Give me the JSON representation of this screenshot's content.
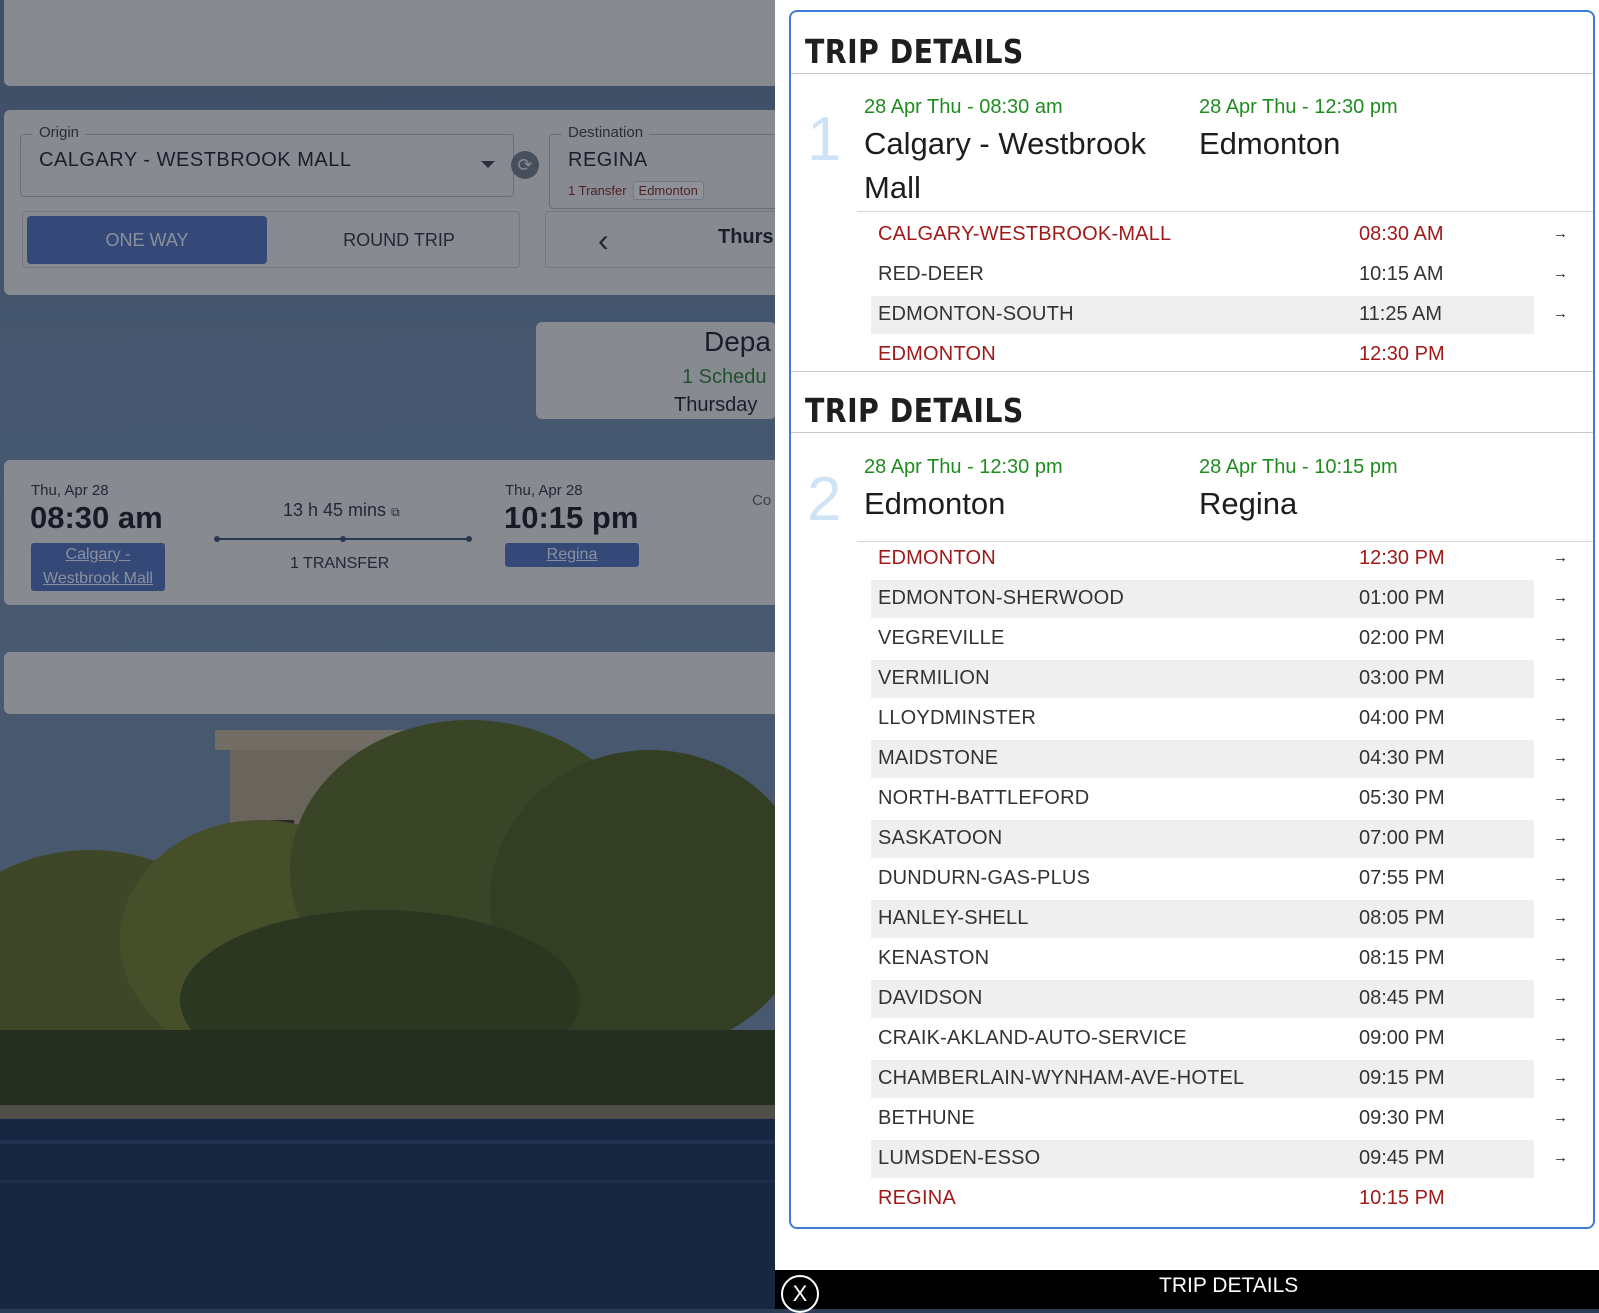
{
  "background": {
    "origin": {
      "legend": "Origin",
      "value": "CALGARY - WESTBROOK MALL"
    },
    "destination": {
      "legend": "Destination",
      "value": "REGINA",
      "transfer_note": "1 Transfer",
      "transfer_city": "Edmonton"
    },
    "trip_type": {
      "one_way": "ONE WAY",
      "round_trip": "ROUND TRIP"
    },
    "date_label": "Thurs",
    "departure": {
      "title": "Depa",
      "schedule": "1 Schedu",
      "day": "Thursday"
    },
    "result": {
      "depart_date": "Thu, Apr 28",
      "depart_time": "08:30 am",
      "depart_station": "Calgary - Westbrook Mall",
      "duration": "13 h 45 mins",
      "transfers": "1 TRANSFER",
      "arrive_date": "Thu, Apr 28",
      "arrive_time": "10:15 pm",
      "arrive_station": "Regina",
      "co_label": "Co"
    }
  },
  "modal": {
    "legs": [
      {
        "title": "TRIP DETAILS",
        "number": "1",
        "depart_datetime": "28 Apr Thu - 08:30 am",
        "depart_city": "Calgary - Westbrook Mall",
        "arrive_datetime": "28 Apr Thu - 12:30 pm",
        "arrive_city": "Edmonton",
        "stops": [
          {
            "name": "CALGARY-WESTBROOK-MALL",
            "time": "08:30 AM"
          },
          {
            "name": "RED-DEER",
            "time": "10:15 AM"
          },
          {
            "name": "EDMONTON-SOUTH",
            "time": "11:25 AM"
          },
          {
            "name": "EDMONTON",
            "time": "12:30 PM"
          }
        ]
      },
      {
        "title": "TRIP DETAILS",
        "number": "2",
        "depart_datetime": "28 Apr Thu - 12:30 pm",
        "depart_city": "Edmonton",
        "arrive_datetime": "28 Apr Thu - 10:15 pm",
        "arrive_city": "Regina",
        "stops": [
          {
            "name": "EDMONTON",
            "time": "12:30 PM"
          },
          {
            "name": "EDMONTON-SHERWOOD",
            "time": "01:00 PM"
          },
          {
            "name": "VEGREVILLE",
            "time": "02:00 PM"
          },
          {
            "name": "VERMILION",
            "time": "03:00 PM"
          },
          {
            "name": "LLOYDMINSTER",
            "time": "04:00 PM"
          },
          {
            "name": "MAIDSTONE",
            "time": "04:30 PM"
          },
          {
            "name": "NORTH-BATTLEFORD",
            "time": "05:30 PM"
          },
          {
            "name": "SASKATOON",
            "time": "07:00 PM"
          },
          {
            "name": "DUNDURN-GAS-PLUS",
            "time": "07:55 PM"
          },
          {
            "name": "HANLEY-SHELL",
            "time": "08:05 PM"
          },
          {
            "name": "KENASTON",
            "time": "08:15 PM"
          },
          {
            "name": "DAVIDSON",
            "time": "08:45 PM"
          },
          {
            "name": "CRAIK-AKLAND-AUTO-SERVICE",
            "time": "09:00 PM"
          },
          {
            "name": "CHAMBERLAIN-WYNHAM-AVE-HOTEL",
            "time": "09:15 PM"
          },
          {
            "name": "BETHUNE",
            "time": "09:30 PM"
          },
          {
            "name": "LUMSDEN-ESSO",
            "time": "09:45 PM"
          },
          {
            "name": "REGINA",
            "time": "10:15 PM"
          }
        ]
      }
    ],
    "arrow_glyph": "→",
    "footer": {
      "close_label": "X",
      "title": "TRIP DETAILS"
    }
  },
  "icons": {
    "swap": "swap-icon",
    "caret": "caret-down-icon",
    "chevron": "chevron-left-icon",
    "external": "external-link-icon",
    "close": "close-icon",
    "arrow": "arrow-right-icon"
  },
  "colors": {
    "accent": "#4d6db3",
    "panel_border": "#3f7ad8",
    "green": "#1e8c1e",
    "endpoint_red": "#a01a1a"
  }
}
